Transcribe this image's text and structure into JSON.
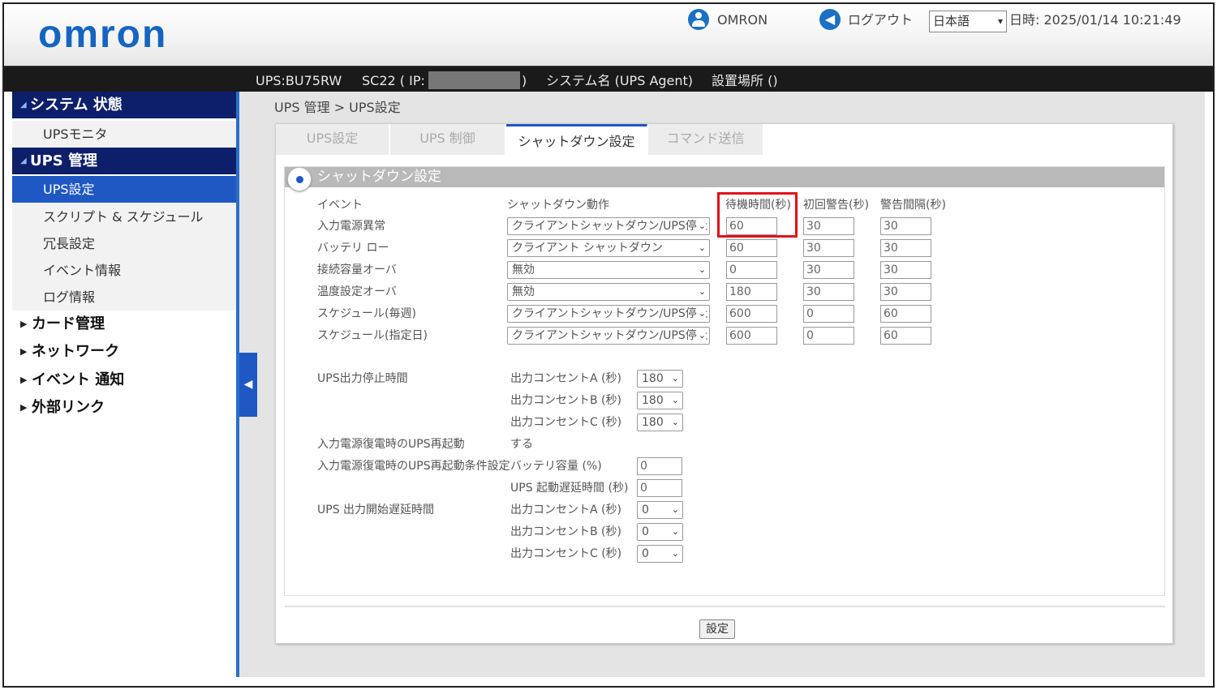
{
  "header": {
    "logo": "omron",
    "user": "OMRON",
    "logout": "ログアウト",
    "language": "日本語",
    "datetime": "日時: 2025/01/14 10:21:49",
    "accent_color": "#1c6fc4",
    "icons": [
      "user-icon",
      "logout-icon"
    ]
  },
  "infobar": {
    "ups": "UPS:BU75RW",
    "card_ip_open": "SC22 ( IP:",
    "card_ip_close": ")",
    "system_name": "システム名 (UPS Agent)",
    "location": "設置場所 ()"
  },
  "sidebar": {
    "system_status": "システム 状態",
    "ups_monitor": "UPSモニタ",
    "ups_management": "UPS 管理",
    "items": [
      "UPS設定",
      "スクリプト & スケジュール",
      "冗長設定",
      "イベント情報",
      "ログ情報"
    ],
    "active_item": "UPS設定",
    "card_management": "カード管理",
    "network": "ネットワーク",
    "event_notification": "イベント 通知",
    "external_links": "外部リンク",
    "nav_color": "#0d1f6b",
    "active_color": "#1f57c3"
  },
  "breadcrumb": "UPS 管理 > UPS設定",
  "tabs": [
    "UPS設定",
    "UPS 制御",
    "シャットダウン設定",
    "コマンド送信"
  ],
  "active_tab": "シャットダウン設定",
  "section": {
    "title": "シャットダウン設定",
    "columns": {
      "event": "イベント",
      "action": "シャットダウン動作",
      "wait": "待機時間(秒)",
      "first_warning": "初回警告(秒)",
      "warning_interval": "警告間隔(秒)"
    },
    "rows": [
      {
        "event": "入力電源異常",
        "action": "クライアントシャットダウン/UPS停止",
        "wait": "60",
        "first": "30",
        "interval": "30"
      },
      {
        "event": "バッテリ ロー",
        "action": "クライアント シャットダウン",
        "wait": "60",
        "first": "30",
        "interval": "30"
      },
      {
        "event": "接続容量オーバ",
        "action": "無効",
        "wait": "0",
        "first": "30",
        "interval": "30"
      },
      {
        "event": "温度設定オーバ",
        "action": "無効",
        "wait": "180",
        "first": "30",
        "interval": "30"
      },
      {
        "event": "スケジュール(毎週)",
        "action": "クライアントシャットダウン/UPS停止",
        "wait": "600",
        "first": "0",
        "interval": "60"
      },
      {
        "event": "スケジュール(指定日)",
        "action": "クライアントシャットダウン/UPS停止",
        "wait": "600",
        "first": "0",
        "interval": "60"
      }
    ],
    "output_stop": {
      "label": "UPS出力停止時間",
      "outlets": [
        {
          "label": "出力コンセントA (秒)",
          "value": "180"
        },
        {
          "label": "出力コンセントB (秒)",
          "value": "180"
        },
        {
          "label": "出力コンセントC (秒)",
          "value": "180"
        }
      ]
    },
    "restart": {
      "label": "入力電源復電時のUPS再起動",
      "value": "する"
    },
    "restart_condition": {
      "label": "入力電源復電時のUPS再起動条件設定",
      "battery_label": "バッテリ容量 (%)",
      "battery_value": "0",
      "delay_label": "UPS 起動遅延時間 (秒)",
      "delay_value": "0"
    },
    "output_start_delay": {
      "label": "UPS 出力開始遅延時間",
      "outlets": [
        {
          "label": "出力コンセントA (秒)",
          "value": "0"
        },
        {
          "label": "出力コンセントB (秒)",
          "value": "0"
        },
        {
          "label": "出力コンセントC (秒)",
          "value": "0"
        }
      ]
    }
  },
  "submit_label": "設定",
  "highlight_color": "#e0121c"
}
